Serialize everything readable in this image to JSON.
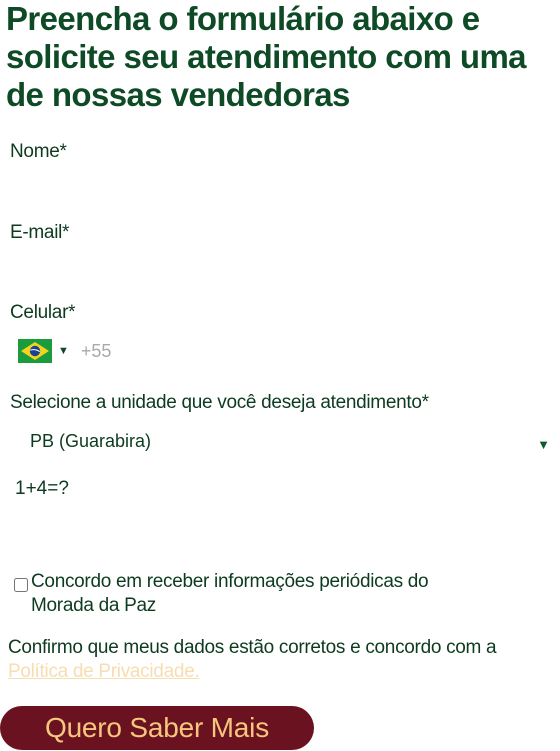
{
  "headline": "Preencha o formulário abaixo e solicite seu atendimento com uma de nossas vendedoras",
  "form": {
    "name_label": "Nome*",
    "email_label": "E-mail*",
    "phone_label": "Celular*",
    "phone_country_icon": "brazil-flag",
    "phone_dial_code": "+55",
    "unit_label": "Selecione a unidade que você deseja atendimento*",
    "unit_selected": "PB (Guarabira)",
    "captcha_label": "1+4=?",
    "consent_text": "Concordo em receber informações periódicas do Morada da Paz",
    "privacy_text": "Confirmo que meus dados estão corretos e concordo com a",
    "privacy_link": "Política de Privacidade.",
    "submit_label": "Quero Saber Mais"
  },
  "colors": {
    "headline": "#0d4a25",
    "button_bg": "#6b1221",
    "button_text": "#f5c77e",
    "link": "#f7ddb0"
  }
}
